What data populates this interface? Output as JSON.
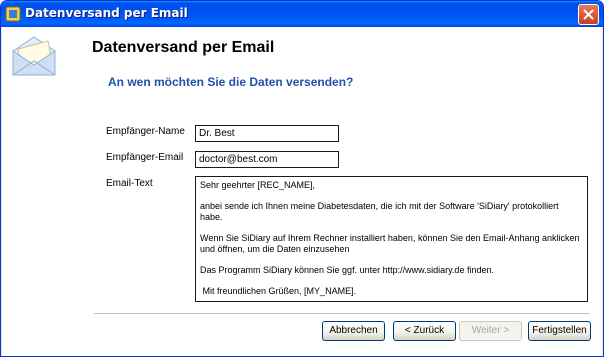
{
  "window": {
    "title": "Datenversand per Email",
    "app_icon": "sidiary-app-icon",
    "close_icon": "close-icon"
  },
  "header": {
    "icon": "envelope-icon",
    "title": "Datenversand per Email",
    "subtitle": "An wen möchten Sie die Daten versenden?"
  },
  "form": {
    "recipient_name_label": "Empfänger-Name",
    "recipient_name_value": "Dr. Best",
    "recipient_email_label": "Empfänger-Email",
    "recipient_email_value": "doctor@best.com",
    "email_text_label": "Email-Text",
    "email_text_paragraphs": [
      "Sehr geehrter [REC_NAME],",
      "anbei sende ich Ihnen meine Diabetesdaten, die ich mit der Software 'SiDiary' protokolliert habe.",
      "Wenn Sie SiDiary auf Ihrem Rechner installiert haben, können Sie den Email-Anhang anklicken und öffnen, um die Daten einzusehen",
      "Das Programm SiDiary können Sie ggf. unter http://www.sidiary.de finden.",
      " Mit freundlichen Grüßen, [MY_NAME]."
    ]
  },
  "buttons": {
    "cancel": "Abbrechen",
    "back": "< Zurück",
    "next": "Weiter >",
    "finish": "Fertigstellen"
  },
  "colors": {
    "titlebar": "#0055ea",
    "subtitle": "#2352a6",
    "dialog_bg": "#ece9d8"
  }
}
